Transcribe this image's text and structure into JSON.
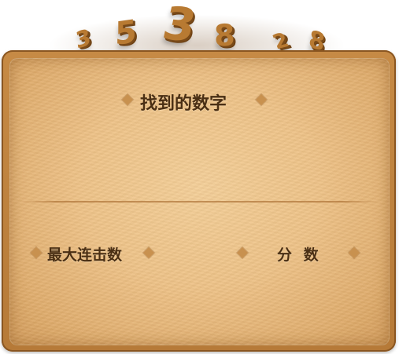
{
  "header_digits": [
    "3",
    "5",
    "3",
    "8",
    "2",
    "8"
  ],
  "panel": {
    "found_numbers_label": "找到的数字",
    "max_combo_label": "最大连击数",
    "score_label": "分 数"
  },
  "colors": {
    "panel_border": "#b67a38",
    "panel_fill": "#eec287",
    "label_text": "#4a2f14",
    "accent_diamond": "#c8914f"
  }
}
